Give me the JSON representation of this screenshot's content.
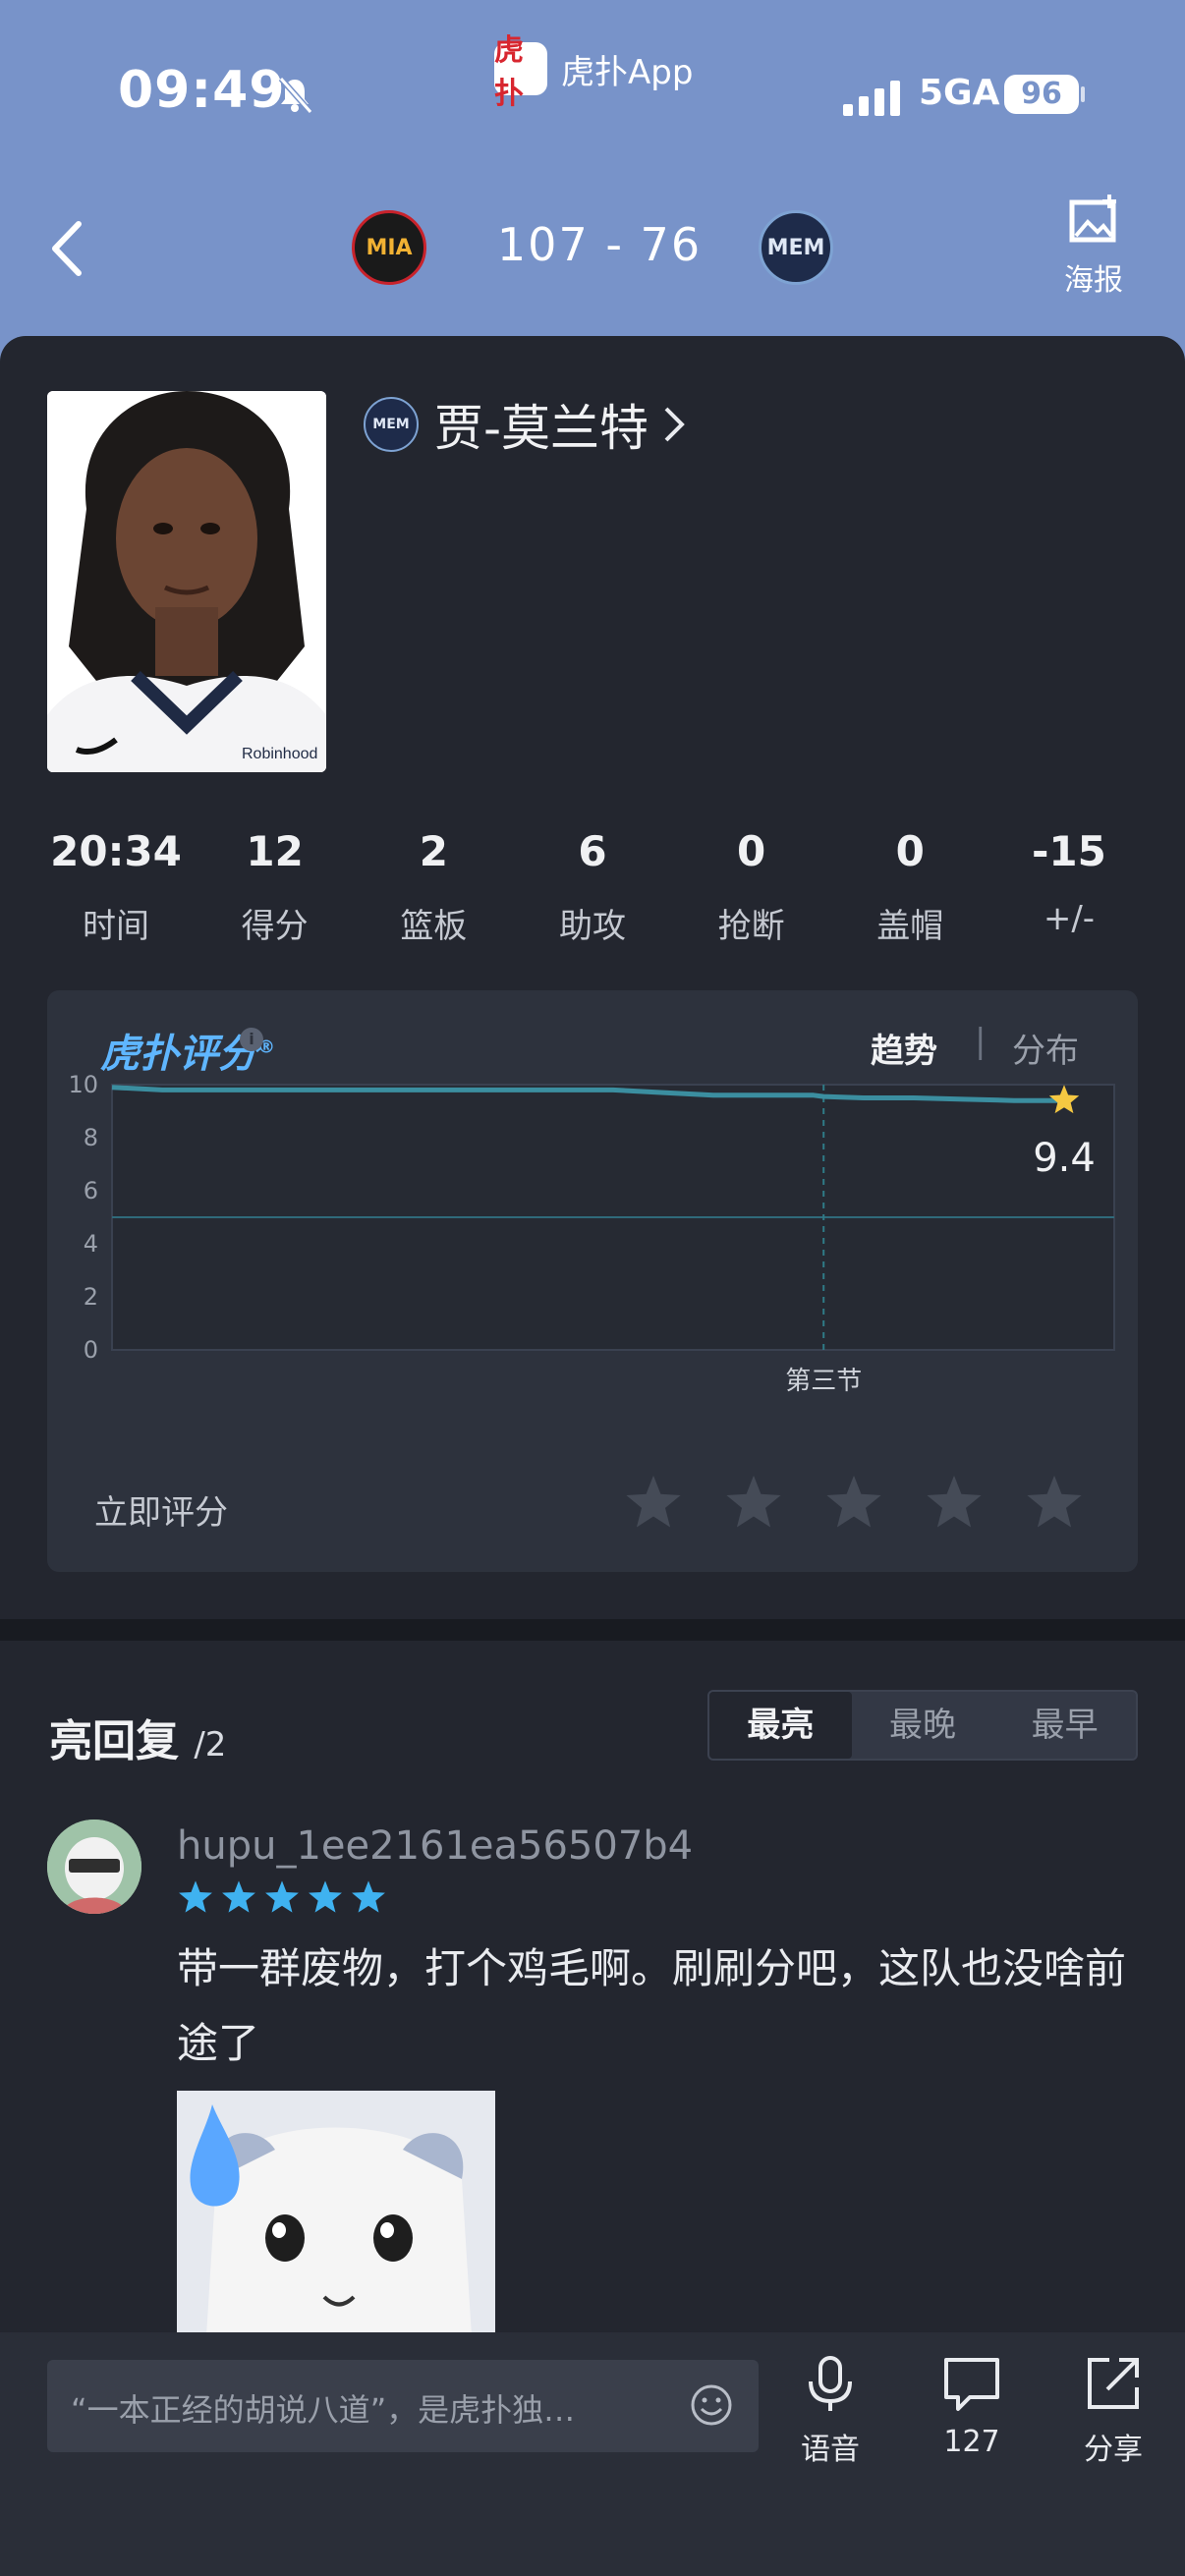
{
  "status_bar": {
    "time": "09:49",
    "app_name": "虎扑App",
    "app_logo_text": "虎扑",
    "network": "5GA",
    "battery": "96"
  },
  "game": {
    "home_team_abbr": "MIA",
    "away_team_abbr": "MEM",
    "score": "107  -  76",
    "poster_label": "海报"
  },
  "player": {
    "team_abbr": "MEM",
    "name": "贾-莫兰特",
    "jersey_sponsor": "Robinhood"
  },
  "stats": [
    {
      "value": "20:34",
      "label": "时间"
    },
    {
      "value": "12",
      "label": "得分"
    },
    {
      "value": "2",
      "label": "篮板"
    },
    {
      "value": "6",
      "label": "助攻"
    },
    {
      "value": "0",
      "label": "抢断"
    },
    {
      "value": "0",
      "label": "盖帽"
    },
    {
      "value": "-15",
      "label": "+/-"
    }
  ],
  "rating": {
    "brand": "虎扑评分",
    "registered": "®",
    "tab_trend": "趋势",
    "tab_separator": "|",
    "tab_distribution": "分布",
    "current_score": "9.4",
    "rate_now_label": "立即评分",
    "star_count": 5,
    "accent_color": "#5fb6ff"
  },
  "chart_data": {
    "type": "line",
    "x_label_marker": "第三节",
    "ylim": [
      0,
      10
    ],
    "yticks": [
      "0",
      "2",
      "4",
      "6",
      "8",
      "10"
    ],
    "series": [
      {
        "x": [
          0,
          0.05,
          0.1,
          0.2,
          0.3,
          0.4,
          0.5,
          0.55,
          0.6,
          0.7,
          0.71,
          0.75,
          0.8,
          0.85,
          0.9,
          0.95
        ],
        "values": [
          9.9,
          9.8,
          9.8,
          9.8,
          9.8,
          9.8,
          9.8,
          9.7,
          9.6,
          9.6,
          9.55,
          9.5,
          9.5,
          9.45,
          9.4,
          9.4
        ]
      }
    ],
    "quarter_marker_x": 0.71,
    "grid": true
  },
  "replies": {
    "title": "亮回复",
    "count": "/2",
    "sort_tabs": [
      "最亮",
      "最晚",
      "最早"
    ],
    "active_tab": 0
  },
  "comment": {
    "user": "hupu_1ee2161ea56507b4",
    "stars": 5,
    "text": "带一群废物，打个鸡毛啊。刷刷分吧，这队也没啥前途了"
  },
  "bottom_bar": {
    "input_placeholder": "“一本正经的胡说八道”，是虎扑独…",
    "voice_label": "语音",
    "comments_count": "127",
    "share_label": "分享"
  }
}
